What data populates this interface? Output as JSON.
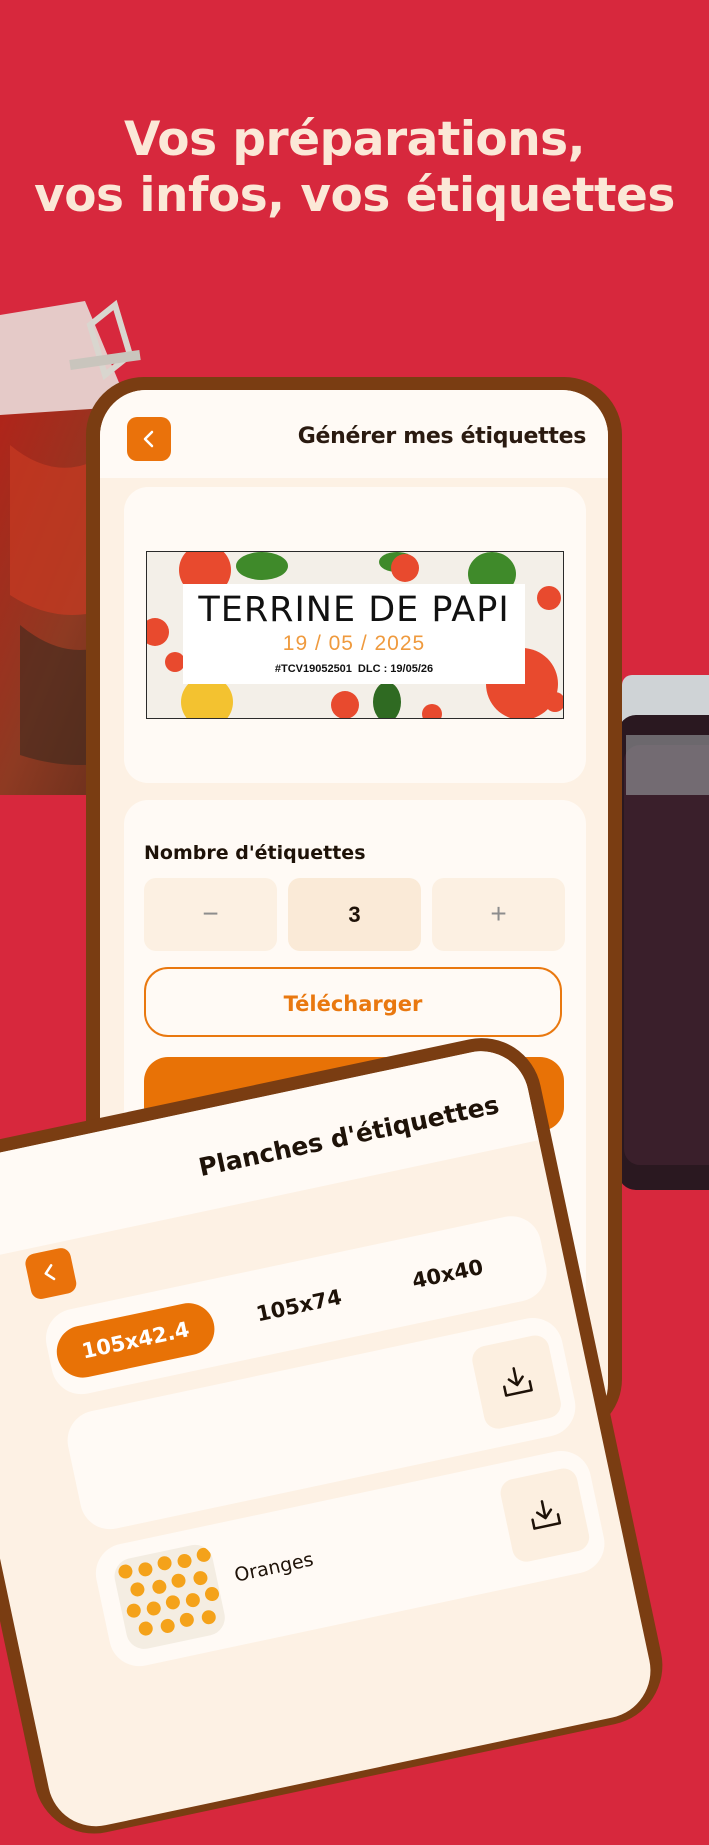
{
  "headline": {
    "line1": "Vos préparations,",
    "line2": "vos infos, vos étiquettes"
  },
  "colors": {
    "background": "#d7283d",
    "accent": "#e87206",
    "frame": "#7a3d12",
    "headline": "#fbe8d7"
  },
  "screen": {
    "title": "Générer mes étiquettes",
    "back_icon": "chevron-left-icon",
    "label_preview": {
      "name": "TERRINE DE PAPI",
      "date": "19 / 05 / 2025",
      "code": "#TCV19052501",
      "dlc": "DLC : 19/05/26"
    },
    "count": {
      "label": "Nombre d'étiquettes",
      "minus": "−",
      "value": "3",
      "plus": "+"
    },
    "download_label": "Télécharger"
  },
  "sheets_screen": {
    "title": "Planches d'étiquettes",
    "tabs": [
      {
        "label": "105x42.4",
        "active": true
      },
      {
        "label": "105x74",
        "active": false
      },
      {
        "label": "40x40",
        "active": false
      }
    ],
    "items": [
      {
        "name": "Oranges",
        "download_icon": "download-icon"
      },
      {
        "name": "",
        "download_icon": "download-icon"
      }
    ]
  }
}
